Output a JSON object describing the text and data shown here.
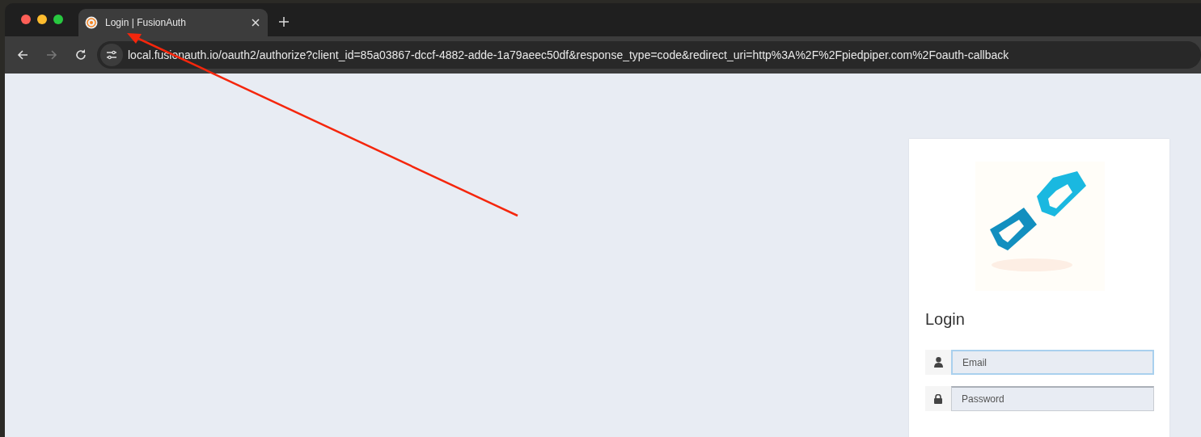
{
  "tabs": [
    {
      "title": "Login | FusionAuth",
      "selected": true
    }
  ],
  "address_bar": {
    "url": "local.fusionauth.io/oauth2/authorize?client_id=85a03867-dccf-4882-adde-1a79aeec50df&response_type=code&redirect_uri=http%3A%2F%2Fpiedpiper.com%2Foauth-callback"
  },
  "login": {
    "heading": "Login",
    "fields": [
      {
        "kind": "email",
        "placeholder": "Email",
        "focused": true
      },
      {
        "kind": "password",
        "placeholder": "Password",
        "focused": false
      }
    ]
  }
}
